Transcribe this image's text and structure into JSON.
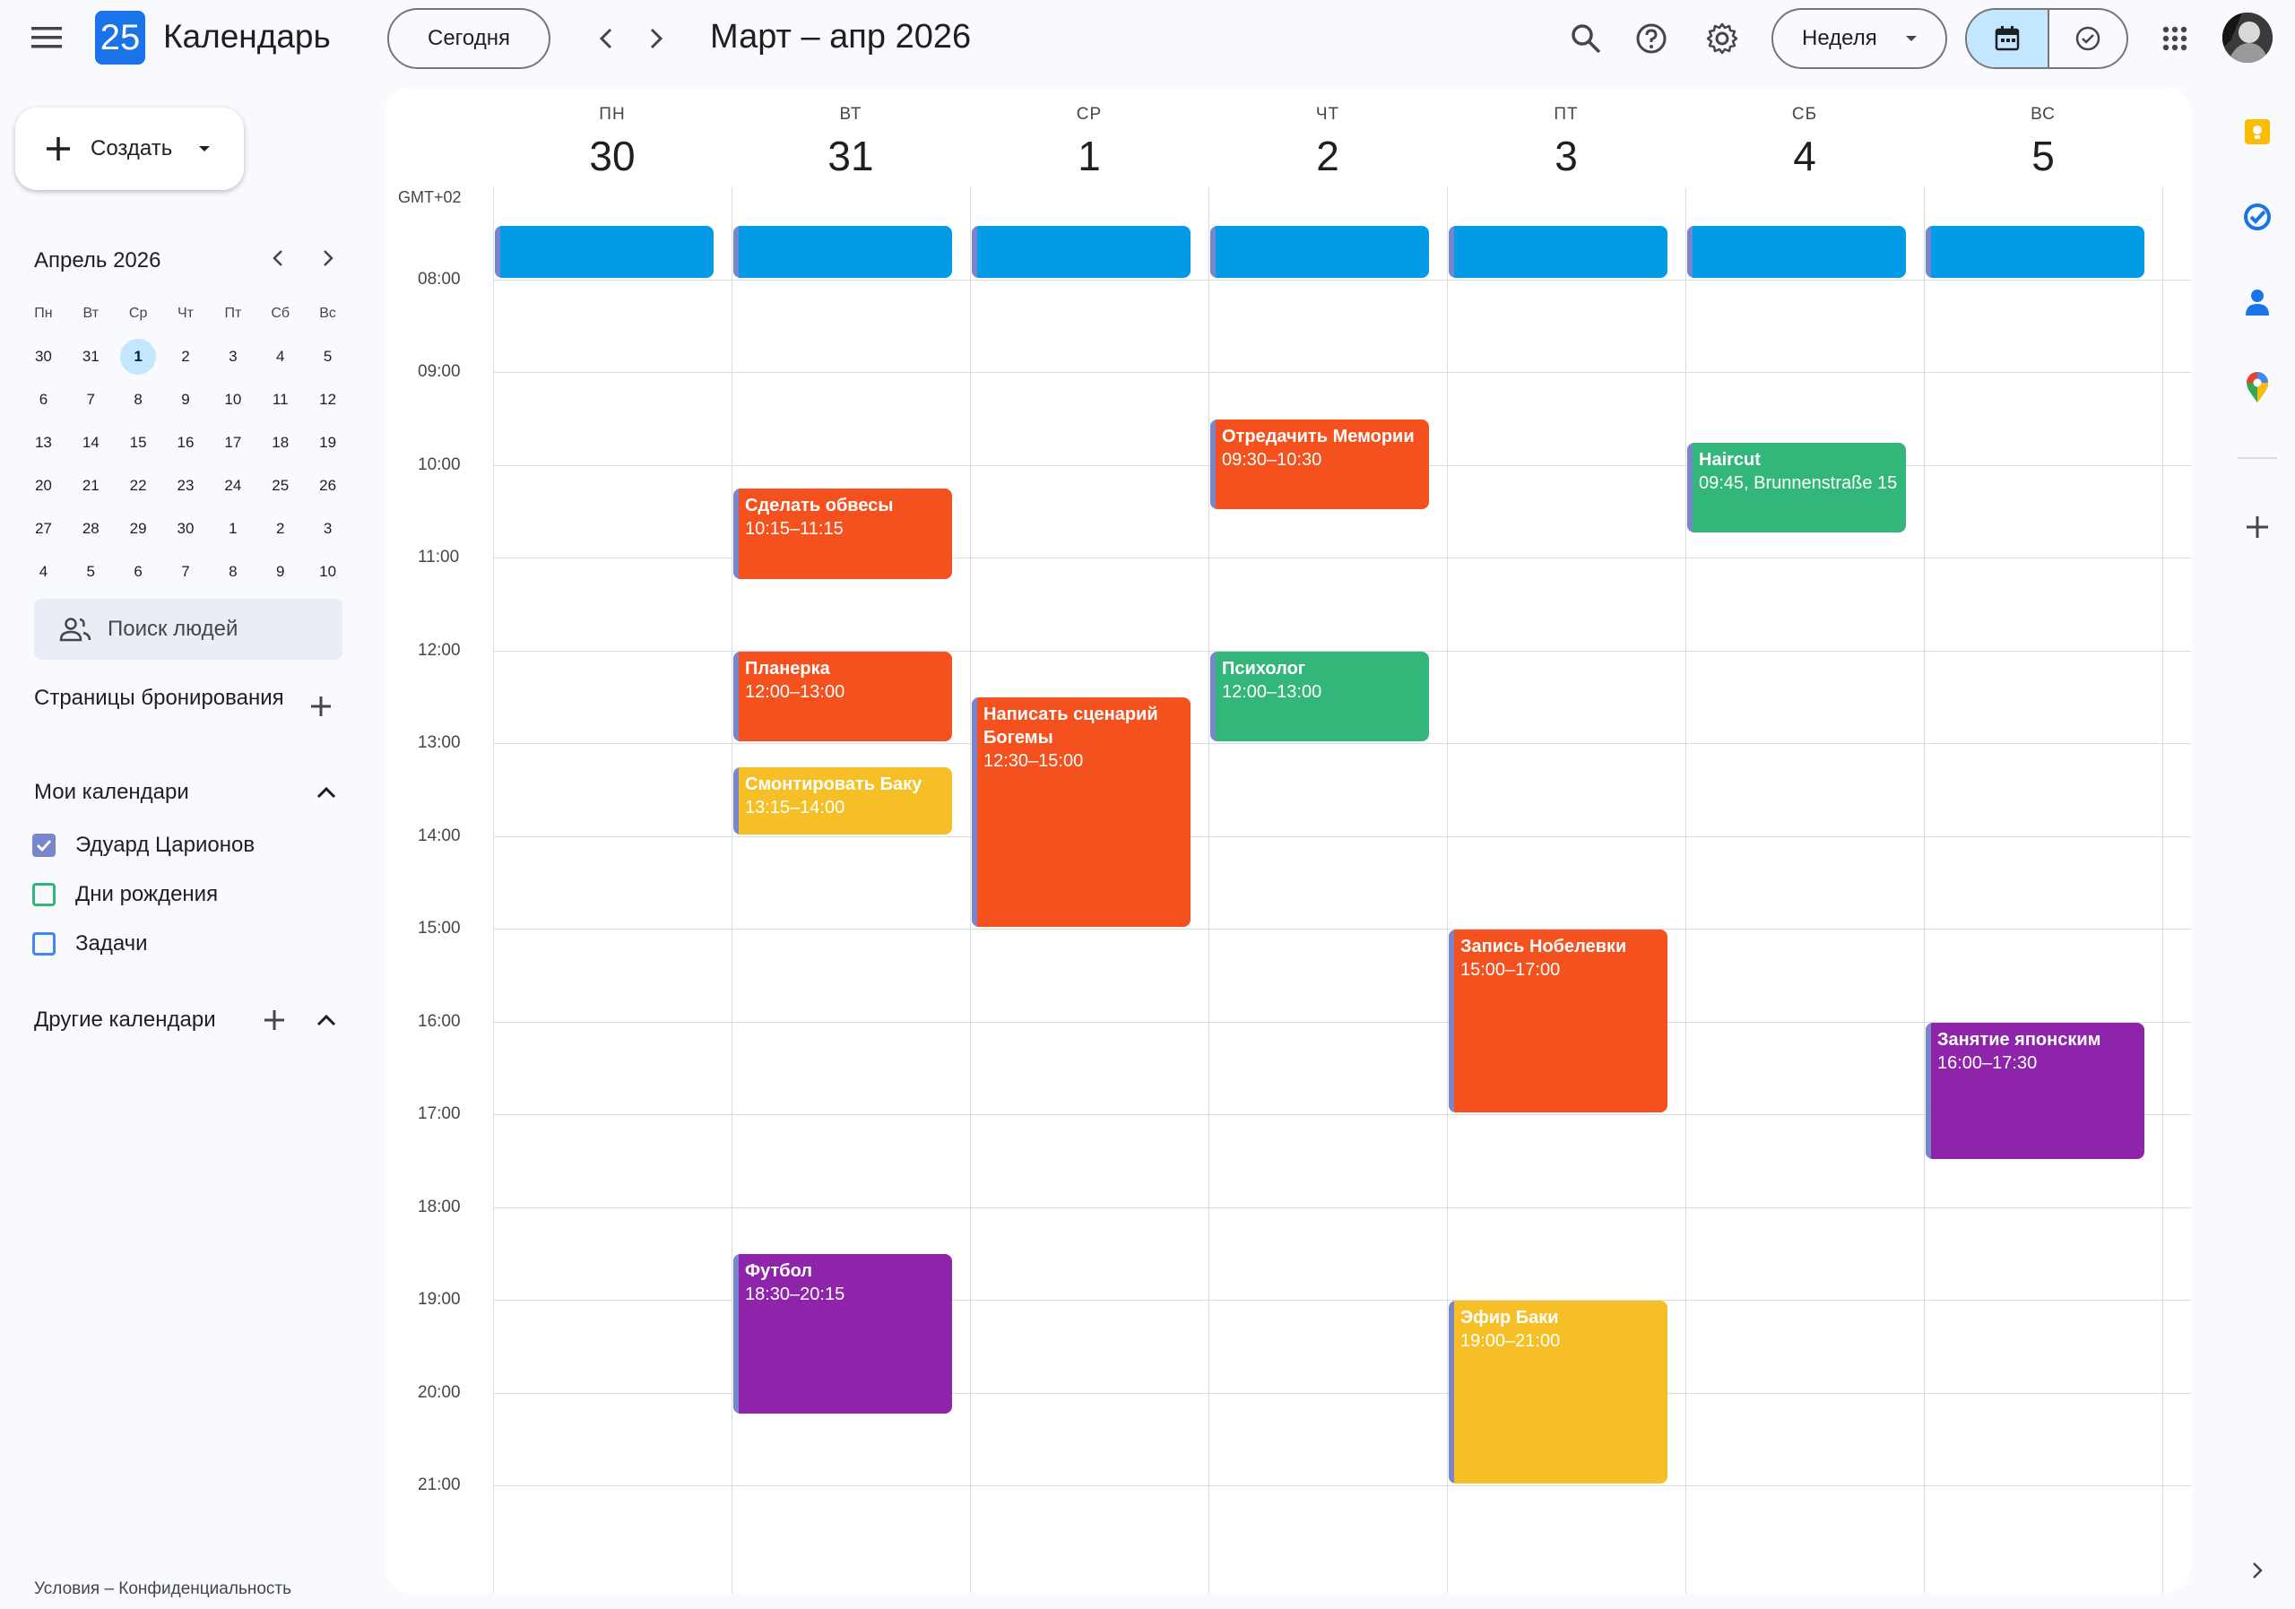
{
  "app": {
    "logo_day": "25",
    "title": "Календарь"
  },
  "toolbar": {
    "today_label": "Сегодня",
    "range_title": "Март – апр 2026",
    "view_label": "Неделя"
  },
  "sidebar": {
    "create_label": "Создать",
    "mini_calendar": {
      "title": "Апрель 2026",
      "weekdays": [
        "Пн",
        "Вт",
        "Ср",
        "Чт",
        "Пт",
        "Сб",
        "Вс"
      ],
      "weeks": [
        [
          "30",
          "31",
          "1",
          "2",
          "3",
          "4",
          "5"
        ],
        [
          "6",
          "7",
          "8",
          "9",
          "10",
          "11",
          "12"
        ],
        [
          "13",
          "14",
          "15",
          "16",
          "17",
          "18",
          "19"
        ],
        [
          "20",
          "21",
          "22",
          "23",
          "24",
          "25",
          "26"
        ],
        [
          "27",
          "28",
          "29",
          "30",
          "1",
          "2",
          "3"
        ],
        [
          "4",
          "5",
          "6",
          "7",
          "8",
          "9",
          "10"
        ]
      ],
      "selected": "1"
    },
    "people_search_placeholder": "Поиск людей",
    "booking_pages_label": "Страницы бронирования",
    "my_calendars_label": "Мои календари",
    "my_calendars": [
      {
        "name": "Эдуард Царионов",
        "color": "#7986cb",
        "checked": true
      },
      {
        "name": "Дни рождения",
        "color": "#33b679",
        "checked": false
      },
      {
        "name": "Задачи",
        "color": "#4285f4",
        "checked": false
      }
    ],
    "other_calendars_label": "Другие календари",
    "footer": "Условия – Конфиденциальность"
  },
  "week": {
    "timezone": "GMT+02",
    "days": [
      {
        "dow": "ПН",
        "num": "30"
      },
      {
        "dow": "ВТ",
        "num": "31"
      },
      {
        "dow": "СР",
        "num": "1"
      },
      {
        "dow": "ЧТ",
        "num": "2"
      },
      {
        "dow": "ПТ",
        "num": "3"
      },
      {
        "dow": "СБ",
        "num": "4"
      },
      {
        "dow": "ВС",
        "num": "5"
      }
    ],
    "hours": [
      "08:00",
      "09:00",
      "10:00",
      "11:00",
      "12:00",
      "13:00",
      "14:00",
      "15:00",
      "16:00",
      "17:00",
      "18:00",
      "19:00",
      "20:00",
      "21:00"
    ]
  },
  "colors": {
    "blue": "#039be5",
    "orange": "#f4511e",
    "green": "#33b679",
    "yellow": "#f6bf26",
    "purple": "#8e24aa",
    "accent": "#1a73e8"
  },
  "events": [
    {
      "day": 0,
      "title": "",
      "time": "",
      "start": "07:25",
      "end": "08:00",
      "color": "#039be5"
    },
    {
      "day": 1,
      "title": "",
      "time": "",
      "start": "07:25",
      "end": "08:00",
      "color": "#039be5"
    },
    {
      "day": 2,
      "title": "",
      "time": "",
      "start": "07:25",
      "end": "08:00",
      "color": "#039be5"
    },
    {
      "day": 3,
      "title": "",
      "time": "",
      "start": "07:25",
      "end": "08:00",
      "color": "#039be5"
    },
    {
      "day": 4,
      "title": "",
      "time": "",
      "start": "07:25",
      "end": "08:00",
      "color": "#039be5"
    },
    {
      "day": 5,
      "title": "",
      "time": "",
      "start": "07:25",
      "end": "08:00",
      "color": "#039be5"
    },
    {
      "day": 6,
      "title": "",
      "time": "",
      "start": "07:25",
      "end": "08:00",
      "color": "#039be5"
    },
    {
      "day": 1,
      "title": "Сделать обвесы",
      "time": "10:15–11:15",
      "start": "10:15",
      "end": "11:15",
      "color": "#f4511e"
    },
    {
      "day": 1,
      "title": "Планерка",
      "time": "12:00–13:00",
      "start": "12:00",
      "end": "13:00",
      "color": "#f4511e"
    },
    {
      "day": 1,
      "title": "Смонтировать Баку",
      "time": "13:15–14:00",
      "start": "13:15",
      "end": "14:00",
      "color": "#f6bf26"
    },
    {
      "day": 1,
      "title": "Футбол",
      "time": "18:30–20:15",
      "start": "18:30",
      "end": "20:15",
      "color": "#8e24aa"
    },
    {
      "day": 2,
      "title": "Написать сценарий Богемы",
      "time": "12:30–15:00",
      "start": "12:30",
      "end": "15:00",
      "color": "#f4511e",
      "wrap": true
    },
    {
      "day": 3,
      "title": "Отредачить Мемории",
      "time": "09:30–10:30",
      "start": "09:30",
      "end": "10:30",
      "color": "#f4511e"
    },
    {
      "day": 3,
      "title": "Психолог",
      "time": "12:00–13:00",
      "start": "12:00",
      "end": "13:00",
      "color": "#33b679"
    },
    {
      "day": 4,
      "title": "Запись Нобелевки",
      "time": "15:00–17:00",
      "start": "15:00",
      "end": "17:00",
      "color": "#f4511e"
    },
    {
      "day": 4,
      "title": "Эфир Баки",
      "time": "19:00–21:00",
      "start": "19:00",
      "end": "21:00",
      "color": "#f6bf26"
    },
    {
      "day": 5,
      "title": "Haircut",
      "time": "09:45, Brunnenstraße 15",
      "start": "09:45",
      "end": "10:45",
      "color": "#33b679"
    },
    {
      "day": 6,
      "title": "Занятие японским",
      "time": "16:00–17:30",
      "start": "16:00",
      "end": "17:30",
      "color": "#8e24aa"
    }
  ],
  "right_panel": [
    "keep-icon",
    "tasks-icon",
    "contacts-icon",
    "maps-icon",
    "add-addon-icon"
  ]
}
